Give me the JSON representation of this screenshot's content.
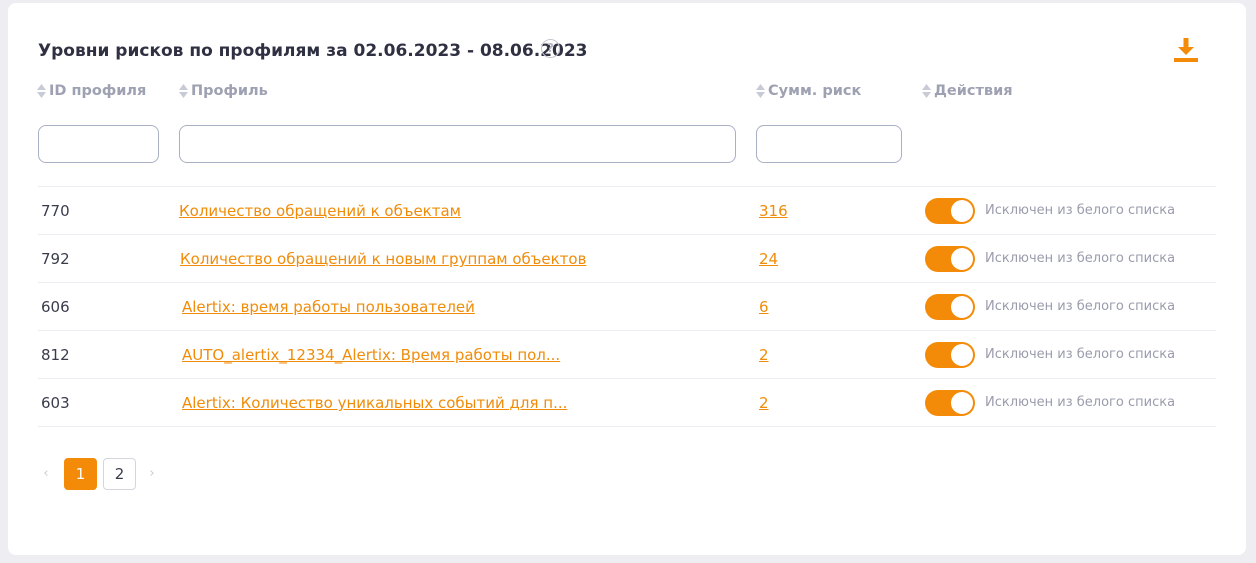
{
  "header": {
    "title": "Уровни рисков по профилям за 02.06.2023 - 08.06.2023",
    "help_icon": "?",
    "download_icon": "download-icon"
  },
  "columns": {
    "id": "ID профиля",
    "profile": "Профиль",
    "risk": "Сумм. риск",
    "actions": "Действия"
  },
  "filters": {
    "id_value": "",
    "profile_value": "",
    "risk_value": ""
  },
  "rows": [
    {
      "id": "770",
      "profile": "Количество обращений к объектам",
      "risk": "316",
      "toggle_on": true,
      "status": "Исключен из белого списка"
    },
    {
      "id": "792",
      "profile": "Количество обращений к новым группам объектов",
      "risk": "24",
      "toggle_on": true,
      "status": "Исключен из белого списка"
    },
    {
      "id": "606",
      "profile": "Alertix: время работы пользователей",
      "risk": "6",
      "toggle_on": true,
      "status": "Исключен из белого списка"
    },
    {
      "id": "812",
      "profile": "AUTO_alertix_12334_Alertix: Время работы пол...",
      "risk": "2",
      "toggle_on": true,
      "status": "Исключен из белого списка"
    },
    {
      "id": "603",
      "profile": "Alertix: Количество уникальных событий для п...",
      "risk": "2",
      "toggle_on": true,
      "status": "Исключен из белого списка"
    }
  ],
  "pagination": {
    "prev": "‹",
    "pages": [
      "1",
      "2"
    ],
    "active_page": "1",
    "next": "›"
  },
  "colors": {
    "accent": "#f38b08",
    "link": "#f08c0a",
    "header_text": "#9ea1b2",
    "title_text": "#2f3142"
  }
}
